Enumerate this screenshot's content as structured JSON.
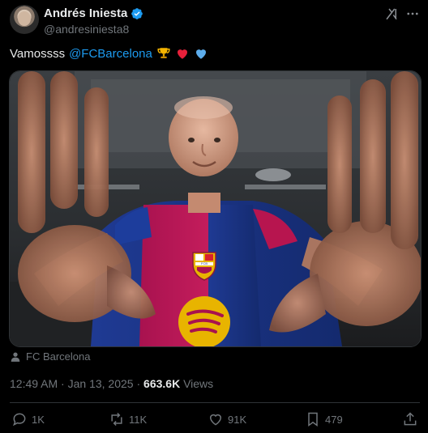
{
  "author": {
    "name": "Andrés Iniesta",
    "handle": "@andresiniesta8",
    "verified": true
  },
  "tweet": {
    "text": "Vamossss",
    "mention": "@FCBarcelona",
    "emojis": [
      "trophy",
      "red-heart",
      "blue-heart"
    ]
  },
  "media": {
    "kit_crest": "FCB"
  },
  "location": "FC Barcelona",
  "meta": {
    "time": "12:49 AM",
    "separator": "·",
    "date": "Jan 13, 2025",
    "views_count": "663.6K",
    "views_label": "Views"
  },
  "actions": {
    "replies": "1K",
    "reposts": "11K",
    "likes": "91K",
    "bookmarks": "479"
  },
  "colors": {
    "background": "#000000",
    "link": "#1d9bf0",
    "muted": "#71767b",
    "text": "#e7e9ea",
    "divider": "#2f3336"
  }
}
